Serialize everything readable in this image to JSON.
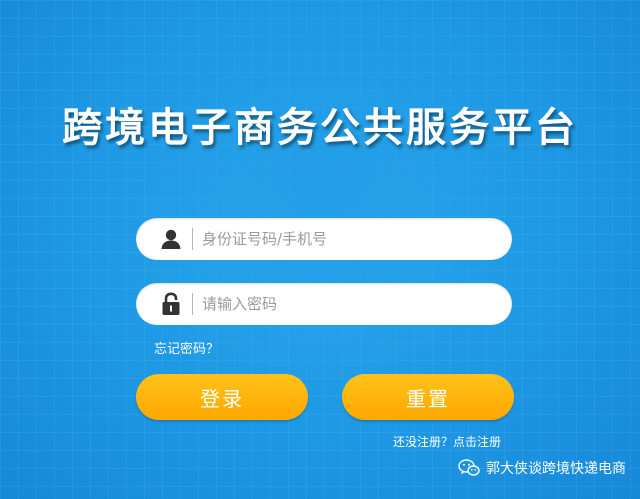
{
  "title": "跨境电子商务公共服务平台",
  "login_form": {
    "username_placeholder": "身份证号码/手机号",
    "password_placeholder": "请输入密码",
    "forgot_password": "忘记密码？",
    "login_button": "登录",
    "reset_button": "重置",
    "register_link": "还没注册？点击注册"
  },
  "icons": {
    "username": "user-icon",
    "password": "lock-icon",
    "watermark": "wechat-icon"
  },
  "watermark": {
    "text": "郭大侠谈跨境快递电商"
  },
  "colors": {
    "background": "#1f9be6",
    "button": "#ffa800",
    "text": "#ffffff"
  }
}
